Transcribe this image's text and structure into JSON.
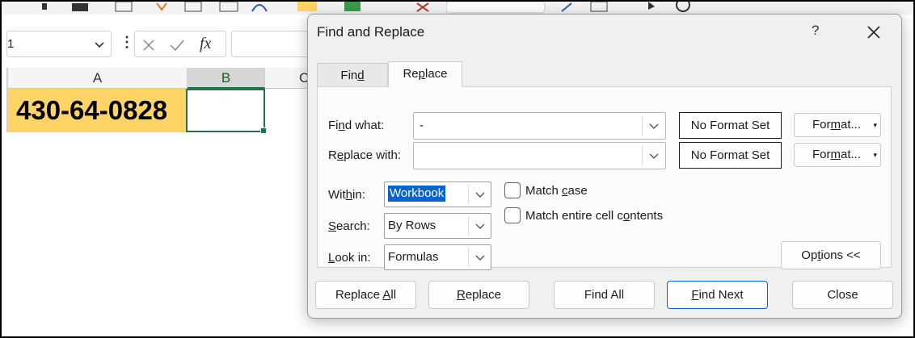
{
  "spreadsheet": {
    "namebox_value": "1",
    "columns": [
      "A",
      "B",
      "C"
    ],
    "cell_a1_value": "430-64-0828",
    "fx_label": "fx"
  },
  "dialog": {
    "title": "Find and Replace",
    "help": "?",
    "tabs": {
      "find": {
        "pre": "Fin",
        "key": "d",
        "post": ""
      },
      "replace": {
        "pre": "Re",
        "key": "p",
        "post": "lace"
      }
    },
    "find_what": {
      "pre": "Fi",
      "key": "n",
      "post": "d what:",
      "value": "-",
      "format": "No Format Set"
    },
    "replace_with": {
      "pre": "R",
      "key": "e",
      "post": "place with:",
      "value": "",
      "format": "No Format Set"
    },
    "format_button": {
      "pre": "For",
      "key": "m",
      "post": "at..."
    },
    "within": {
      "pre": "Wit",
      "key": "h",
      "post": "in:",
      "value": "Workbook"
    },
    "search": {
      "pre": "",
      "key": "S",
      "post": "earch:",
      "value": "By Rows"
    },
    "look_in": {
      "pre": "",
      "key": "L",
      "post": "ook in:",
      "value": "Formulas"
    },
    "match_case": {
      "pre": "Match ",
      "key": "c",
      "post": "ase",
      "checked": false
    },
    "match_entire": {
      "pre": "Match entire cell c",
      "key": "o",
      "post": "ntents",
      "checked": false
    },
    "options": {
      "pre": "Op",
      "key": "t",
      "post": "ions <<"
    },
    "buttons": {
      "replace_all": {
        "pre": "Replace ",
        "key": "A",
        "post": "ll"
      },
      "replace": {
        "pre": "",
        "key": "R",
        "post": "eplace"
      },
      "find_all": {
        "pre": "Find A",
        "key": "",
        "post": "ll"
      },
      "find_next": {
        "pre": "",
        "key": "F",
        "post": "ind Next"
      },
      "close": "Close"
    }
  }
}
